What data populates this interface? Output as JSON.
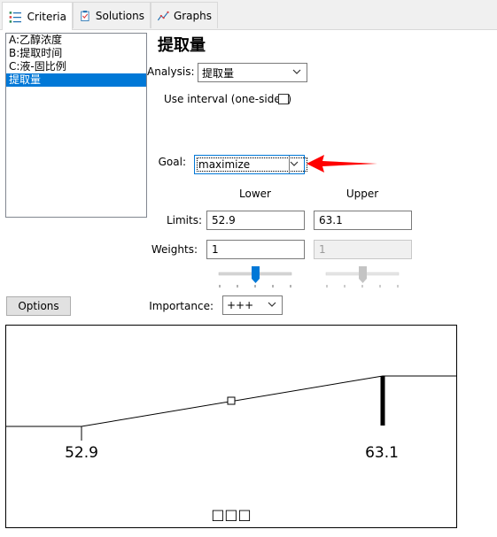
{
  "tabs": [
    {
      "label": "Criteria",
      "icon": "criteria-icon"
    },
    {
      "label": "Solutions",
      "icon": "solutions-icon"
    },
    {
      "label": "Graphs",
      "icon": "graphs-icon"
    }
  ],
  "factors": [
    "A:乙醇浓度",
    "B:提取时间",
    "C:液-固比例",
    "提取量"
  ],
  "selected_index": 3,
  "response_title": "提取量",
  "analysis": {
    "label": "Analysis:",
    "value": "提取量"
  },
  "use_interval": {
    "label": "Use interval (one-sided)",
    "checked": false
  },
  "goal": {
    "label": "Goal:",
    "value": "maximize"
  },
  "columns": {
    "lower": "Lower",
    "upper": "Upper"
  },
  "limits": {
    "label": "Limits:",
    "lower": "52.9",
    "upper": "63.1"
  },
  "weights": {
    "label": "Weights:",
    "lower": "1",
    "upper": "1"
  },
  "options_button": "Options",
  "importance": {
    "label": "Importance:",
    "value": "+++"
  },
  "desirability_graph": {
    "lower_label": "52.9",
    "upper_label": "63.1",
    "footer_text": "□□□"
  },
  "colors": {
    "accent": "#0078d7",
    "arrow": "#ff0000"
  }
}
